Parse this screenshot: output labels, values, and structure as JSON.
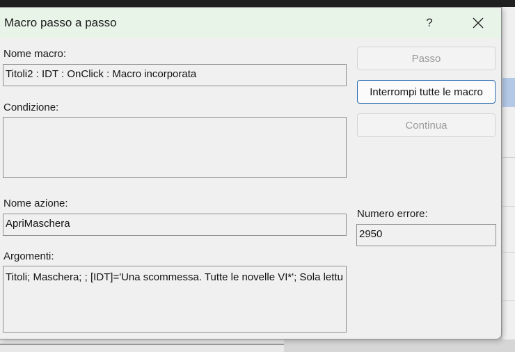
{
  "dialog": {
    "title": "Macro passo a passo",
    "help_label": "?",
    "macro_name_label": "Nome macro:",
    "macro_name_value": "Titoli2 : IDT : OnClick : Macro incorporata",
    "condition_label": "Condizione:",
    "condition_value": "",
    "action_name_label": "Nome azione:",
    "action_name_value": "ApriMaschera",
    "arguments_label": "Argomenti:",
    "arguments_value": "Titoli; Maschera; ; [IDT]='Una scommessa. Tutte le novelle VI*'; Sola lettu",
    "error_number_label": "Numero errore:",
    "error_number_value": "2950",
    "buttons": {
      "step": "Passo",
      "stop_all": "Interrompi tutte le macro",
      "continue": "Continua"
    }
  }
}
